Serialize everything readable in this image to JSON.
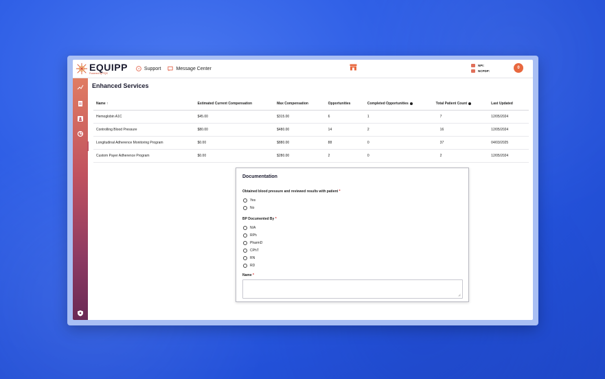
{
  "app": {
    "logo_name": "EQUIPP",
    "logo_sub": "Powered by PQS",
    "nav": [
      {
        "label": "Support",
        "icon": "help-circle-icon"
      },
      {
        "label": "Message Center",
        "icon": "message-icon"
      }
    ],
    "provider": {
      "npi_label": "NPI:",
      "ncpdp_label": "NCPDP:"
    },
    "avatar_initial": "0",
    "brand_color": "#e8683f"
  },
  "sidebar": {
    "items": [
      {
        "icon": "trend-chart-icon"
      },
      {
        "icon": "document-icon"
      },
      {
        "icon": "patient-card-icon"
      },
      {
        "icon": "enhanced-services-icon"
      },
      {
        "icon": "shield-icon"
      }
    ]
  },
  "page": {
    "title": "Enhanced Services",
    "columns": [
      "Name ↑",
      "Estimated Current Compensation",
      "Max Compensation",
      "Opportunities",
      "Completed Opportunities",
      "Total Patient Count",
      "Last Updated"
    ],
    "rows": [
      [
        "Hemoglobin A1C",
        "$45.00",
        "$315.00",
        "6",
        "1",
        "7",
        "12/05/2024"
      ],
      [
        "Controlling Blood Pressure",
        "$80.00",
        "$480.00",
        "14",
        "2",
        "16",
        "12/05/2024"
      ],
      [
        "Longitudinal Adherence Monitoring Program",
        "$0.00",
        "$880.00",
        "88",
        "0",
        "37",
        "04/03/2025"
      ],
      [
        "Custom Payer Adherence Program",
        "$0.00",
        "$280.00",
        "2",
        "0",
        "2",
        "12/05/2024"
      ]
    ]
  },
  "modal": {
    "title": "Documentation",
    "q1": "Obtained blood pressure and reviewed results with patient",
    "q1_options": [
      "Yes",
      "No"
    ],
    "q2": "BP Documented By",
    "q2_options": [
      "N/A",
      "RPh",
      "PharmD",
      "CPhT",
      "RN",
      "RD"
    ],
    "q3": "Name",
    "required_mark": "*"
  }
}
